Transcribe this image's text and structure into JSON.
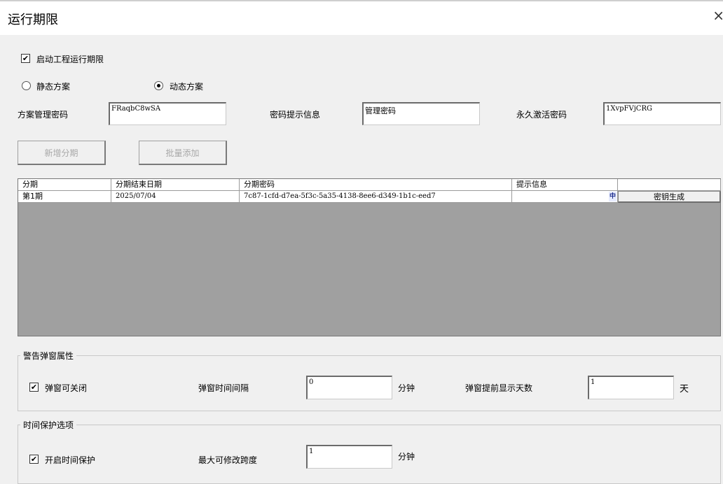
{
  "window": {
    "title": "运行期限",
    "close_glyph": "×"
  },
  "enable_limit": {
    "label": "启动工程运行期限",
    "checked": true
  },
  "scheme": {
    "static_label": "静态方案",
    "dynamic_label": "动态方案",
    "selected": "dynamic"
  },
  "fields": {
    "manage_pwd_label": "方案管理密码",
    "manage_pwd_value": "FRaqbC8wSA",
    "hint_label": "密码提示信息",
    "hint_value": "管理密码",
    "perm_label": "永久激活密码",
    "perm_value": "1XvpFVjCRG"
  },
  "buttons": {
    "add_period": "新增分期",
    "batch_add": "批量添加"
  },
  "table": {
    "columns": [
      "分期",
      "分期结束日期",
      "分期密码",
      "提示信息",
      ""
    ],
    "rows": [
      {
        "period": "第1期",
        "end_date": "2025/07/04",
        "password": "7c87-1cfd-d7ea-5f3c-5a35-4138-8ee6-d349-1b1c-eed7",
        "hint": "",
        "ime_glyph": "中",
        "action": "密钥生成"
      }
    ]
  },
  "warning": {
    "group_title": "警告弹窗属性",
    "closable_label": "弹窗可关闭",
    "closable_checked": true,
    "interval_label": "弹窗时间间隔",
    "interval_value": "0",
    "interval_unit": "分钟",
    "advance_label": "弹窗提前显示天数",
    "advance_value": "1",
    "advance_unit": "天"
  },
  "protect": {
    "group_title": "时间保护选项",
    "enable_label": "开启时间保护",
    "enable_checked": true,
    "max_span_label": "最大可修改跨度",
    "max_span_value": "1",
    "max_span_unit": "分钟"
  }
}
